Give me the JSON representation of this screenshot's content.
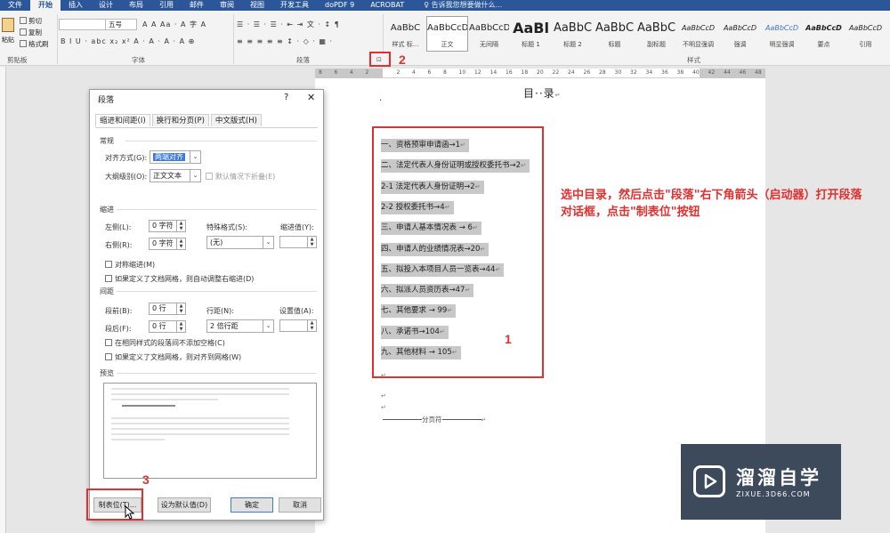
{
  "ribbon": {
    "tabs": [
      "文件",
      "开始",
      "插入",
      "设计",
      "布局",
      "引用",
      "邮件",
      "审阅",
      "视图",
      "开发工具",
      "doPDF 9",
      "ACROBAT"
    ],
    "active_tab": "开始",
    "tell_me": "♀ 告诉我您想要做什么...",
    "clipboard": {
      "cut": "剪切",
      "copy": "复制",
      "format_painter": "格式刷",
      "paste": "粘贴",
      "label": "剪贴板"
    },
    "font": {
      "size": "五号",
      "label": "字体"
    },
    "paragraph": {
      "label": "段落",
      "launcher": "⊡"
    },
    "styles": {
      "label": "样式",
      "items": [
        {
          "sample": "AaBbC",
          "name": "样式 标..."
        },
        {
          "sample": "AaBbCcD",
          "name": "正文"
        },
        {
          "sample": "AaBbCcD",
          "name": "无间隔"
        },
        {
          "sample": "AaBl",
          "name": "标题 1"
        },
        {
          "sample": "AaBbC",
          "name": "标题 2"
        },
        {
          "sample": "AaBbC",
          "name": "标题"
        },
        {
          "sample": "AaBbC",
          "name": "副标题"
        },
        {
          "sample": "AaBbCcD",
          "name": "不明显强调"
        },
        {
          "sample": "AaBbCcD",
          "name": "强调"
        },
        {
          "sample": "AaBbCcD",
          "name": "明显强调"
        },
        {
          "sample": "AaBbCcD",
          "name": "要点"
        },
        {
          "sample": "AaBbCcD",
          "name": "引用"
        }
      ],
      "selected_index": 1
    }
  },
  "ruler": {
    "ticks": [
      "8",
      "6",
      "4",
      "2",
      "",
      "2",
      "4",
      "6",
      "8",
      "10",
      "12",
      "14",
      "16",
      "18",
      "20",
      "22",
      "24",
      "26",
      "28",
      "30",
      "32",
      "34",
      "36",
      "38",
      "40",
      "42",
      "44",
      "46",
      "48"
    ]
  },
  "document": {
    "toc_title": "目··录",
    "return_mark": "↵",
    "toc": [
      "一、资格预审申请函→1",
      "二、法定代表人身份证明或授权委托书→2",
      "2-1 法定代表人身份证明→2",
      "2-2 授权委托书→4",
      "三、申请人基本情况表 → 6",
      "四、申请人的业绩情况表→20",
      "五、拟投入本项目人员一览表→44",
      "六、拟派人员资历表→47",
      "七、其他要求 → 99",
      "八、承诺书→104",
      "九、其他材料 → 105"
    ],
    "page_break": "分页符"
  },
  "annotation": {
    "text": "选中目录，然后点击\"段落\"右下角箭头（启动器）打开段落对话框，点击\"制表位\"按钮",
    "step1": "1",
    "step2": "2",
    "step3": "3",
    "color": "#e03030"
  },
  "dialog": {
    "title": "段落",
    "help": "?",
    "close": "✕",
    "tabs": [
      "缩进和间距(I)",
      "换行和分页(P)",
      "中文版式(H)"
    ],
    "general": {
      "section": "常规",
      "alignment_label": "对齐方式(G):",
      "alignment_value": "两端对齐",
      "outline_label": "大纲级别(O):",
      "outline_value": "正文文本",
      "collapsed_default": "默认情况下折叠(E)"
    },
    "indent": {
      "section": "缩进",
      "left_label": "左侧(L):",
      "left_value": "0 字符",
      "right_label": "右侧(R):",
      "right_value": "0 字符",
      "special_label": "特殊格式(S):",
      "special_value": "(无)",
      "by_label": "缩进值(Y):",
      "mirror": "对称缩进(M)",
      "auto_adjust": "如果定义了文档网格，则自动调整右缩进(D)"
    },
    "spacing": {
      "section": "间距",
      "before_label": "段前(B):",
      "before_value": "0 行",
      "after_label": "段后(F):",
      "after_value": "0 行",
      "line_label": "行距(N):",
      "line_value": "2 倍行距",
      "at_label": "设置值(A):",
      "no_space_same_style": "在相同样式的段落间不添加空格(C)",
      "snap_grid": "如果定义了文档网格，则对齐到网格(W)"
    },
    "preview": {
      "section": "预览"
    },
    "buttons": {
      "tabs": "制表位(T)...",
      "default": "设为默认值(D)",
      "ok": "确定",
      "cancel": "取消"
    }
  },
  "watermark": {
    "title": "溜溜自学",
    "subtitle": "ZIXUE.3D66.COM"
  }
}
